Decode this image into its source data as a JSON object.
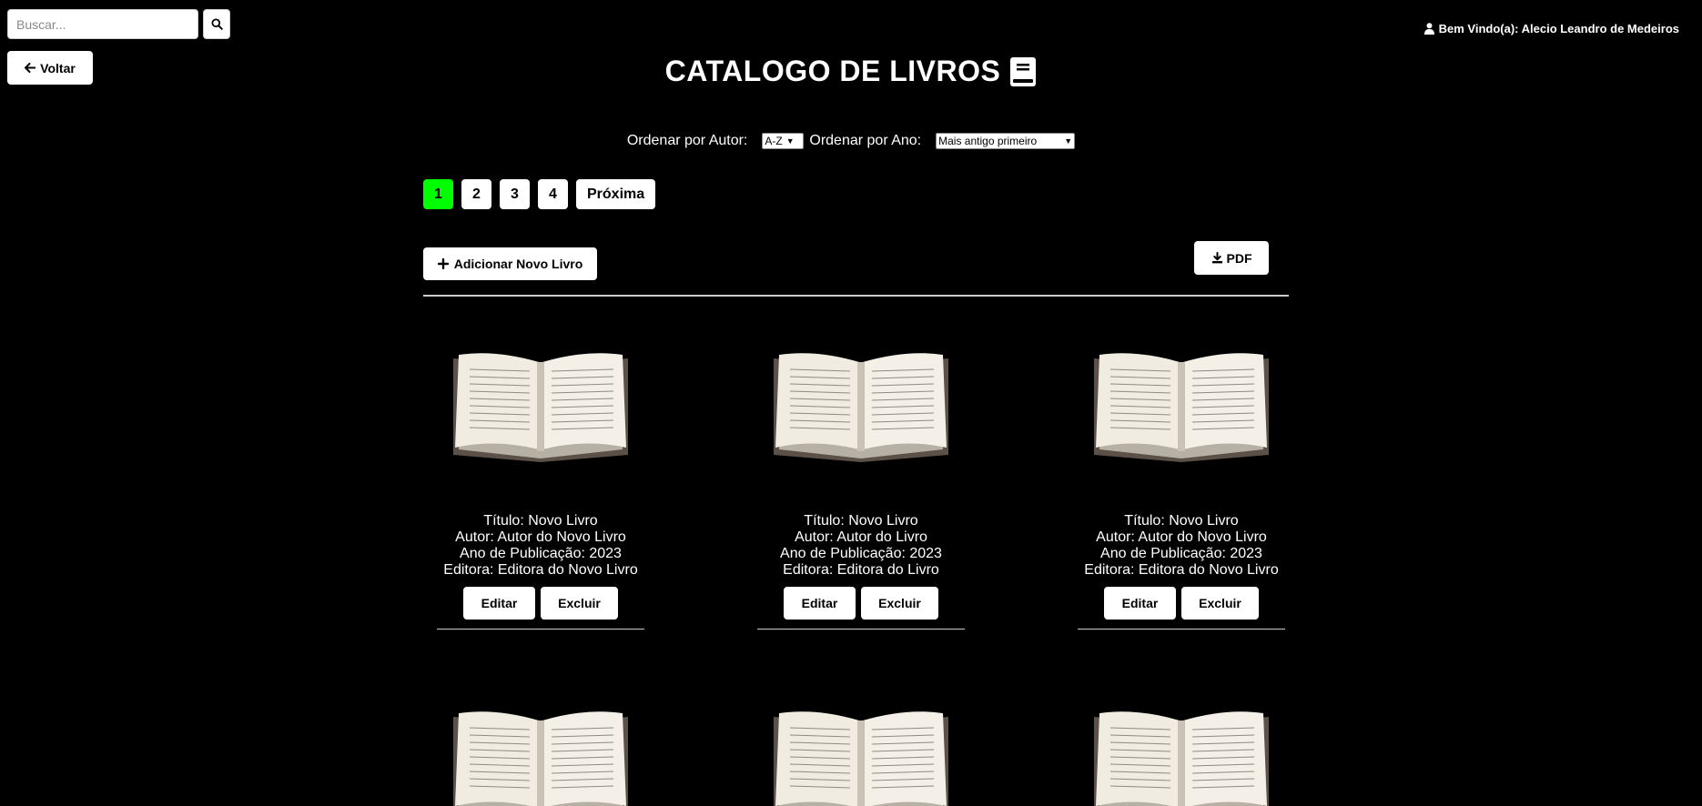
{
  "search": {
    "placeholder": "Buscar..."
  },
  "back_label": "Voltar",
  "welcome_text": "Bem Vindo(a): Alecio Leandro de Medeiros",
  "page_title": "CATALOGO DE LIVROS",
  "sort": {
    "author_label": "Ordenar por Autor:",
    "author_value": "A-Z",
    "year_label": "Ordenar por Ano:",
    "year_value": "Mais antigo primeiro"
  },
  "pagination": {
    "pages": [
      "1",
      "2",
      "3",
      "4"
    ],
    "active": "1",
    "next_label": "Próxima",
    "active_color": "#00ff00"
  },
  "add_label": "Adicionar Novo Livro",
  "pdf_label": "PDF",
  "books": [
    {
      "titulo": "Título: Novo Livro",
      "autor": "Autor: Autor do Novo Livro",
      "ano": "Ano de Publicação: 2023",
      "editora": "Editora: Editora do Novo Livro",
      "edit_label": "Editar",
      "delete_label": "Excluir"
    },
    {
      "titulo": "Título: Novo Livro",
      "autor": "Autor: Autor do Livro",
      "ano": "Ano de Publicação: 2023",
      "editora": "Editora: Editora do Livro",
      "edit_label": "Editar",
      "delete_label": "Excluir"
    },
    {
      "titulo": "Título: Novo Livro",
      "autor": "Autor: Autor do Novo Livro",
      "ano": "Ano de Publicação: 2023",
      "editora": "Editora: Editora do Novo Livro",
      "edit_label": "Editar",
      "delete_label": "Excluir"
    }
  ],
  "icons": {
    "search": "search-icon",
    "back": "arrow-left-icon",
    "user": "user-icon",
    "title_book": "book-icon",
    "add": "plus-icon",
    "pdf": "download-icon",
    "cover": "open-book-image"
  }
}
